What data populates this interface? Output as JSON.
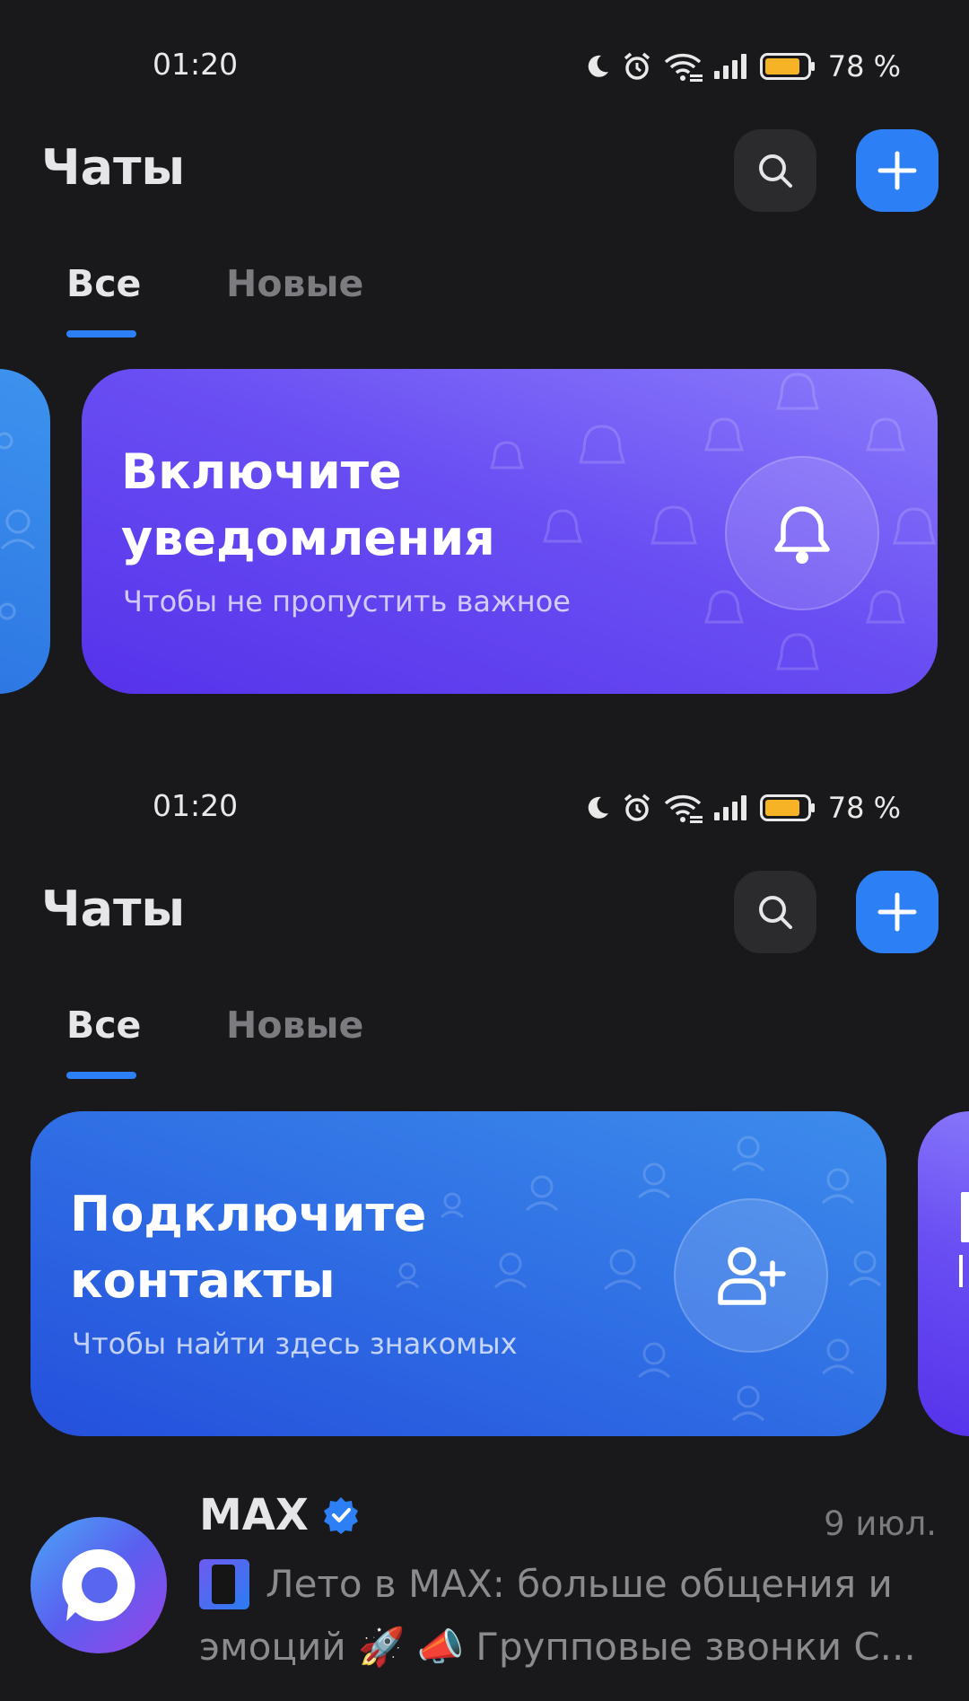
{
  "status_bar": {
    "time": "01:20",
    "battery_percent": "78 %",
    "battery_level": 0.78,
    "icons": [
      "moon-icon",
      "alarm-icon",
      "wifi-icon",
      "signal-icon",
      "battery-icon"
    ]
  },
  "header": {
    "title": "Чаты",
    "search_icon": "search-icon",
    "add_icon": "plus-icon"
  },
  "tabs": [
    {
      "label": "Все",
      "active": true
    },
    {
      "label": "Новые",
      "active": false
    }
  ],
  "cards": {
    "notifications": {
      "title_line1": "Включите",
      "title_line2": "уведомления",
      "subtitle": "Чтобы не пропустить важное",
      "icon": "bell-icon"
    },
    "contacts": {
      "title_line1": "Подключите",
      "title_line2": "контакты",
      "subtitle": "Чтобы найти здесь знакомых",
      "icon": "add-user-icon"
    }
  },
  "chat": {
    "name": "MAX",
    "verified": true,
    "date": "9 июл.",
    "preview_line1": "Лето в MAX: больше общения и",
    "preview_line2": "эмоций 🚀 📣 Групповые звонки С..."
  },
  "colors": {
    "background": "#19191b",
    "accent": "#2d7ff5",
    "card_purple": "#6a4ff3",
    "card_blue": "#2f6ee4",
    "battery": "#f5b325"
  }
}
